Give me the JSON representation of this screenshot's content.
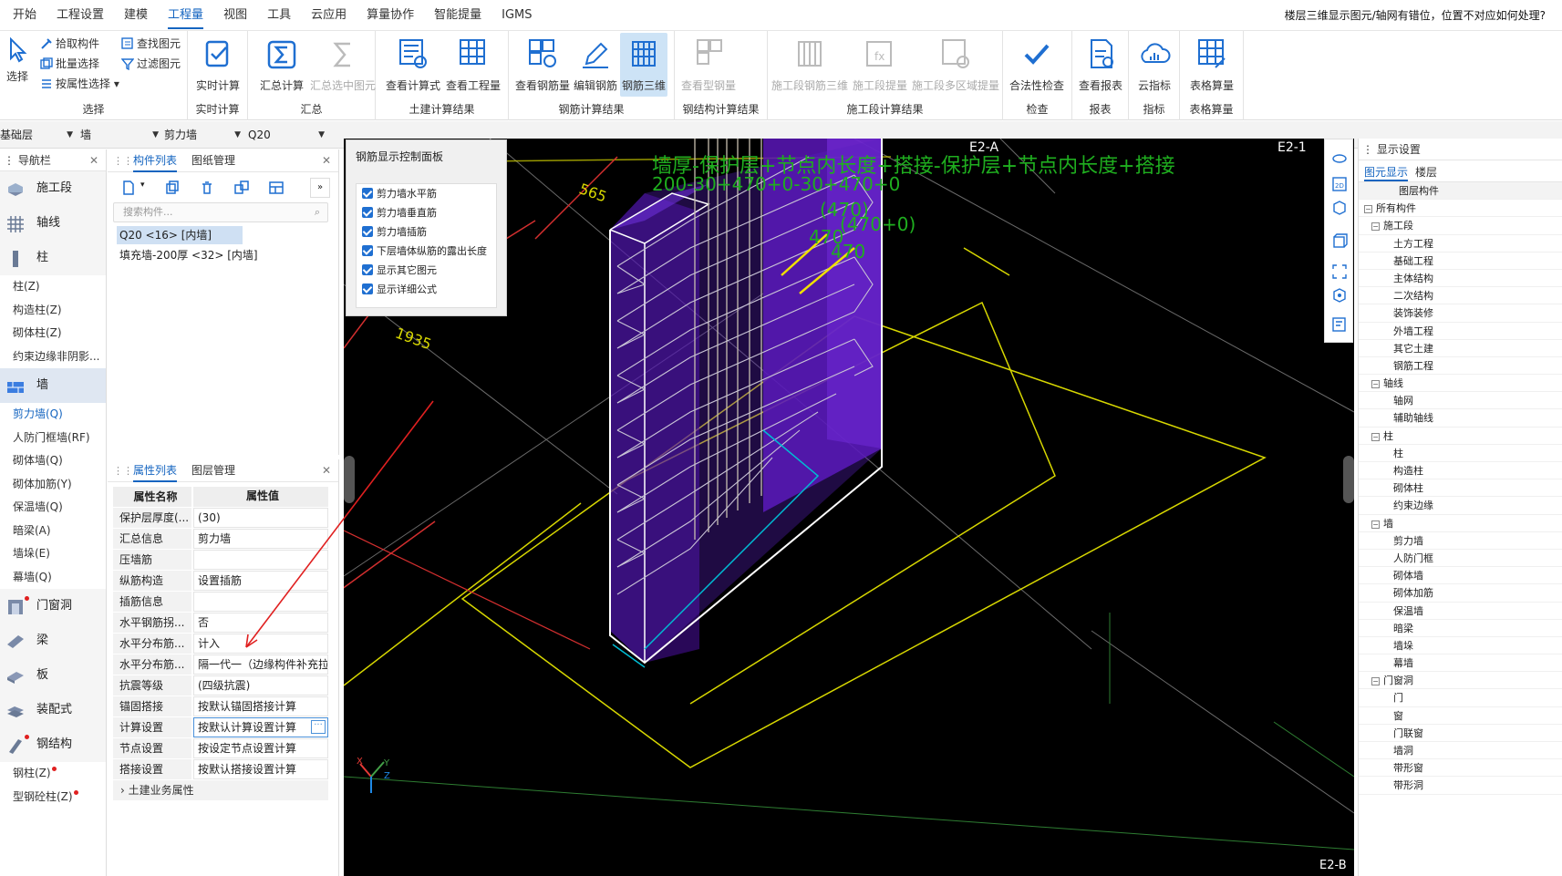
{
  "menu": {
    "items": [
      "开始",
      "工程设置",
      "建模",
      "工程量",
      "视图",
      "工具",
      "云应用",
      "算量协作",
      "智能提量",
      "IGMS"
    ],
    "hint": "楼层三维显示图元/轴网有错位，位置不对应如何处理?"
  },
  "ribbon": {
    "select_big": "选择",
    "select_small": [
      "拾取构件",
      "批量选择",
      "按属性选择",
      "查找图元",
      "过滤图元"
    ],
    "select_group": "选择",
    "realtime": {
      "label": "实时计算",
      "group": "实时计算"
    },
    "sum": {
      "items": [
        "汇总计算",
        "汇总选中图元"
      ],
      "group": "汇总"
    },
    "civil": {
      "items": [
        "查看计算式",
        "查看工程量"
      ],
      "group": "土建计算结果"
    },
    "rebar": {
      "items": [
        "查看钢筋量",
        "编辑钢筋",
        "钢筋三维"
      ],
      "group": "钢筋计算结果"
    },
    "steel": {
      "items": [
        "查看型钢量"
      ],
      "group": "钢结构计算结果"
    },
    "stage": {
      "items": [
        "施工段钢筋三维",
        "施工段提量",
        "施工段多区域提量"
      ],
      "group": "施工段计算结果"
    },
    "check": {
      "items": [
        "合法性检查"
      ],
      "group": "检查"
    },
    "report": {
      "items": [
        "查看报表"
      ],
      "group": "报表"
    },
    "index": {
      "items": [
        "云指标"
      ],
      "group": "指标"
    },
    "table": {
      "items": [
        "表格算量"
      ],
      "group": "表格算量"
    }
  },
  "filter": {
    "floor": "基础层",
    "type": "墙",
    "sub": "剪力墙",
    "name": "Q20"
  },
  "nav": {
    "title": "导航栏",
    "items": [
      {
        "kind": "cat",
        "label": "施工段",
        "icon": "construction-stage-icon"
      },
      {
        "kind": "cat",
        "label": "轴线",
        "icon": "axis-grid-icon"
      },
      {
        "kind": "cat",
        "label": "柱",
        "icon": "column-icon"
      },
      {
        "kind": "sub",
        "label": "柱(Z)"
      },
      {
        "kind": "sub",
        "label": "构造柱(Z)"
      },
      {
        "kind": "sub",
        "label": "砌体柱(Z)"
      },
      {
        "kind": "sub",
        "label": "约束边缘非阴影..."
      },
      {
        "kind": "cat",
        "label": "墙",
        "icon": "wall-icon",
        "selected": true
      },
      {
        "kind": "sub",
        "label": "剪力墙(Q)",
        "active": true
      },
      {
        "kind": "sub",
        "label": "人防门框墙(RF)"
      },
      {
        "kind": "sub",
        "label": "砌体墙(Q)"
      },
      {
        "kind": "sub",
        "label": "砌体加筋(Y)"
      },
      {
        "kind": "sub",
        "label": "保温墙(Q)"
      },
      {
        "kind": "sub",
        "label": "暗梁(A)"
      },
      {
        "kind": "sub",
        "label": "墙垛(E)"
      },
      {
        "kind": "sub",
        "label": "幕墙(Q)"
      },
      {
        "kind": "cat",
        "label": "门窗洞",
        "icon": "door-window-icon",
        "dot": true
      },
      {
        "kind": "cat",
        "label": "梁",
        "icon": "beam-icon"
      },
      {
        "kind": "cat",
        "label": "板",
        "icon": "slab-icon"
      },
      {
        "kind": "cat",
        "label": "装配式",
        "icon": "prefab-icon"
      },
      {
        "kind": "cat",
        "label": "钢结构",
        "icon": "steel-structure-icon",
        "dot": true
      },
      {
        "kind": "sub",
        "label": "钢柱(Z)",
        "dot": true
      },
      {
        "kind": "sub",
        "label": "型钢砼柱(Z)",
        "dot": true
      }
    ]
  },
  "component_list": {
    "tabs": [
      "构件列表",
      "图纸管理"
    ],
    "search_placeholder": "搜索构件...",
    "items": [
      "Q20 <16> [内墙]",
      "填充墙-200厚 <32> [内墙]"
    ]
  },
  "properties": {
    "tabs": [
      "属性列表",
      "图层管理"
    ],
    "head": [
      "属性名称",
      "属性值"
    ],
    "rows": [
      [
        "保护层厚度(...",
        "(30)"
      ],
      [
        "汇总信息",
        "剪力墙"
      ],
      [
        "压墙筋",
        ""
      ],
      [
        "纵筋构造",
        "设置插筋"
      ],
      [
        "插筋信息",
        ""
      ],
      [
        "水平钢筋拐...",
        "否"
      ],
      [
        "水平分布筋...",
        "计入"
      ],
      [
        "水平分布筋...",
        "隔一代一（边缘构件补充拉..."
      ],
      [
        "抗震等级",
        "(四级抗震)"
      ],
      [
        "锚固搭接",
        "按默认锚固搭接计算"
      ],
      [
        "计算设置",
        "按默认计算设置计算"
      ],
      [
        "节点设置",
        "按设定节点设置计算"
      ],
      [
        "搭接设置",
        "按默认搭接设置计算"
      ]
    ],
    "group": "土建业务属性"
  },
  "control_panel": {
    "title": "钢筋显示控制面板",
    "options": [
      "剪力墙水平筋",
      "剪力墙垂直筋",
      "剪力墙插筋",
      "下层墙体纵筋的露出长度",
      "显示其它图元",
      "显示详细公式"
    ]
  },
  "viewport": {
    "formula1": "墙厚-保护层+节点内长度+搭接-保护层+节点内长度+搭接",
    "formula2": "200-30+470+0-30+470+0",
    "dim1": "565",
    "dim2": "1935",
    "val1": "(470)",
    "val2": "(470+0)",
    "val3": "470",
    "val4": "470",
    "axis_a": "E2-A",
    "axis_b": "E2-1",
    "axis_c": "E2-B",
    "axes": [
      "X",
      "Y",
      "Z"
    ]
  },
  "display_panel": {
    "title": "显示设置",
    "tabs": [
      "图元显示",
      "楼层"
    ],
    "header": "图层构件",
    "tree": [
      {
        "level": 0,
        "label": "所有构件",
        "box": true
      },
      {
        "level": 1,
        "label": "施工段",
        "box": true
      },
      {
        "level": 2,
        "label": "土方工程"
      },
      {
        "level": 2,
        "label": "基础工程"
      },
      {
        "level": 2,
        "label": "主体结构"
      },
      {
        "level": 2,
        "label": "二次结构"
      },
      {
        "level": 2,
        "label": "装饰装修"
      },
      {
        "level": 2,
        "label": "外墙工程"
      },
      {
        "level": 2,
        "label": "其它土建"
      },
      {
        "level": 2,
        "label": "钢筋工程"
      },
      {
        "level": 1,
        "label": "轴线",
        "box": true
      },
      {
        "level": 2,
        "label": "轴网"
      },
      {
        "level": 2,
        "label": "辅助轴线"
      },
      {
        "level": 1,
        "label": "柱",
        "box": true
      },
      {
        "level": 2,
        "label": "柱"
      },
      {
        "level": 2,
        "label": "构造柱"
      },
      {
        "level": 2,
        "label": "砌体柱"
      },
      {
        "level": 2,
        "label": "约束边缘"
      },
      {
        "level": 1,
        "label": "墙",
        "box": true
      },
      {
        "level": 2,
        "label": "剪力墙"
      },
      {
        "level": 2,
        "label": "人防门框"
      },
      {
        "level": 2,
        "label": "砌体墙"
      },
      {
        "level": 2,
        "label": "砌体加筋"
      },
      {
        "level": 2,
        "label": "保温墙"
      },
      {
        "level": 2,
        "label": "暗梁"
      },
      {
        "level": 2,
        "label": "墙垛"
      },
      {
        "level": 2,
        "label": "幕墙"
      },
      {
        "level": 1,
        "label": "门窗洞",
        "box": true
      },
      {
        "level": 2,
        "label": "门"
      },
      {
        "level": 2,
        "label": "窗"
      },
      {
        "level": 2,
        "label": "门联窗"
      },
      {
        "level": 2,
        "label": "墙洞"
      },
      {
        "level": 2,
        "label": "带形窗"
      },
      {
        "level": 2,
        "label": "带形洞"
      }
    ]
  },
  "colors": {
    "accent": "#1565c0",
    "rebar_text": "#1fae1f",
    "wall_purple": "#6a1fc9",
    "grid_yellow": "#e5e500"
  }
}
